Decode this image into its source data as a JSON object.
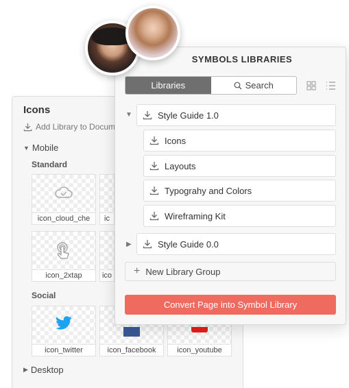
{
  "icons_panel": {
    "title": "Icons",
    "add_library": "Add Library to Docum",
    "section_mobile": "Mobile",
    "sub_standard": "Standard",
    "standard_tiles": [
      "icon_cloud_che",
      "ic",
      "icon_2xtap",
      "ico"
    ],
    "sub_social": "Social",
    "social_tiles": [
      "icon_twitter",
      "icon_facebook",
      "icon_youtube"
    ],
    "section_desktop": "Desktop"
  },
  "library_panel": {
    "title": "SYMBOLS LIBRARIES",
    "tab_libraries": "Libraries",
    "tab_search": "Search",
    "groups": [
      {
        "label": "Style Guide 1.0",
        "expanded": true,
        "items": [
          "Icons",
          "Layouts",
          "Typograhy and Colors",
          "Wireframing Kit"
        ]
      },
      {
        "label": "Style Guide 0.0",
        "expanded": false,
        "items": []
      }
    ],
    "new_group": "New Library Group",
    "convert_button": "Convert Page into Symbol Library"
  },
  "colors": {
    "accent": "#f06b5f",
    "active_tab": "#6f6f6f",
    "twitter": "#1da1f2",
    "facebook": "#3b5998",
    "youtube": "#e62117"
  },
  "icons": [
    "download-icon",
    "search-icon",
    "grid-view-icon",
    "list-view-icon",
    "plus-icon",
    "twitter-icon",
    "cloud-check-icon",
    "double-tap-icon"
  ]
}
